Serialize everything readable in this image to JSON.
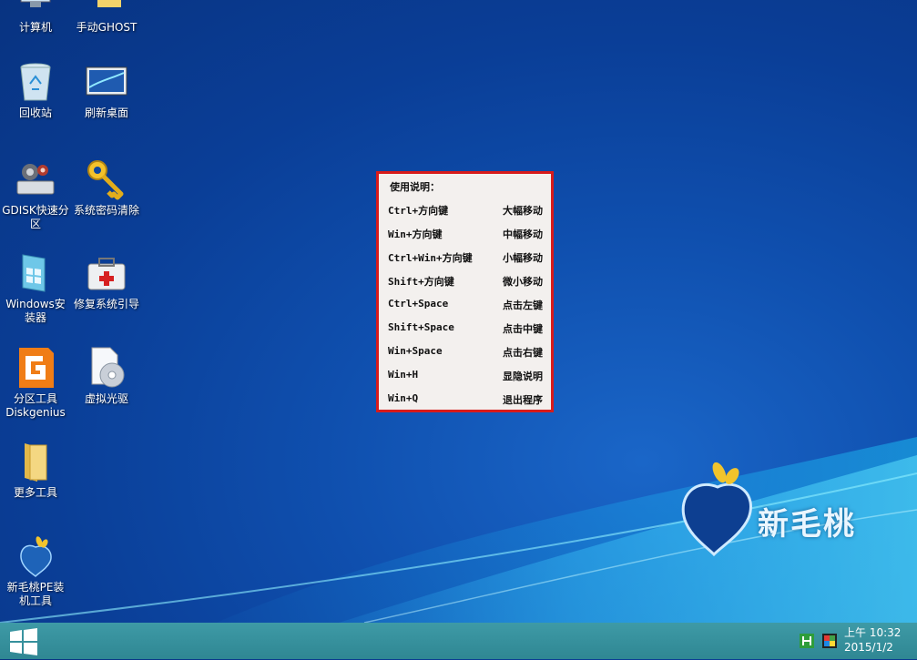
{
  "desktop": {
    "icons": [
      {
        "label": "计算机",
        "icon": "computer-icon"
      },
      {
        "label": "手动GHOST",
        "icon": "ghost-icon"
      },
      {
        "label": "回收站",
        "icon": "recycle-bin-icon"
      },
      {
        "label": "刷新桌面",
        "icon": "refresh-desktop-icon"
      },
      {
        "label": "GDISK快速分区",
        "icon": "gdisk-icon"
      },
      {
        "label": "系统密码清除",
        "icon": "key-icon"
      },
      {
        "label": "Windows安装器",
        "icon": "windows-installer-icon"
      },
      {
        "label": "修复系统引导",
        "icon": "repair-kit-icon"
      },
      {
        "label": "分区工具Diskgenius",
        "icon": "diskgenius-icon"
      },
      {
        "label": "虚拟光驱",
        "icon": "virtual-drive-icon"
      },
      {
        "label": "更多工具",
        "icon": "folder-icon"
      },
      {
        "label": "新毛桃PE装机工具",
        "icon": "peach-logo-icon"
      }
    ]
  },
  "help": {
    "title": "使用说明：",
    "rows": [
      {
        "key": "Ctrl+方向键",
        "action": "大幅移动"
      },
      {
        "key": "Win+方向键",
        "action": "中幅移动"
      },
      {
        "key": "Ctrl+Win+方向键",
        "action": "小幅移动"
      },
      {
        "key": "Shift+方向键",
        "action": "微小移动"
      },
      {
        "key": "Ctrl+Space",
        "action": "点击左键"
      },
      {
        "key": "Shift+Space",
        "action": "点击中键"
      },
      {
        "key": "Win+Space",
        "action": "点击右键"
      },
      {
        "key": "Win+H",
        "action": "显隐说明"
      },
      {
        "key": "Win+Q",
        "action": "退出程序"
      }
    ]
  },
  "brand": {
    "text": "新毛桃"
  },
  "taskbar": {
    "clock_time": "上午 10:32",
    "clock_date": "2015/1/2",
    "tray": [
      "h-app-icon",
      "display-icon"
    ]
  },
  "colors": {
    "help_border": "#d81b1b",
    "taskbar": "#3291a0"
  }
}
